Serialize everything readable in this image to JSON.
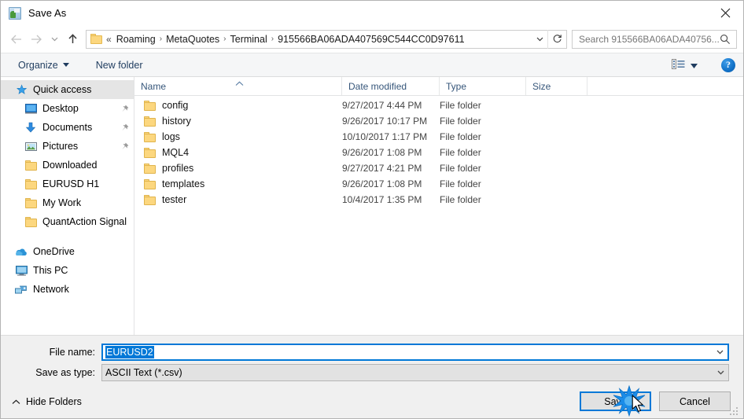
{
  "window": {
    "title": "Save As",
    "title_icon": "save-as-icon",
    "close_label": "✕"
  },
  "nav": {
    "back_icon": "arrow-left-icon",
    "forward_icon": "arrow-right-icon",
    "recent_icon": "chevron-down-icon",
    "up_icon": "arrow-up-icon",
    "address": {
      "folder_icon": "folder-icon",
      "overflow": "«",
      "crumbs": [
        "Roaming",
        "MetaQuotes",
        "Terminal",
        "915566BA06ADA407569C544CC0D97611"
      ],
      "separator": "›",
      "dropdown_icon": "chevron-down-icon",
      "refresh_icon": "refresh-icon"
    },
    "search": {
      "placeholder": "Search 915566BA06ADA40756...",
      "icon": "search-icon"
    }
  },
  "commandbar": {
    "organize_label": "Organize",
    "organize_caret": "chevron-down-icon",
    "new_folder_label": "New folder",
    "view_icon": "view-mode-icon",
    "view_caret": "chevron-down-icon",
    "help_label": "?"
  },
  "sidebar": {
    "items": [
      {
        "label": "Quick access",
        "icon": "star-pin-icon",
        "selected": true,
        "indent": false,
        "pinned": false
      },
      {
        "label": "Desktop",
        "icon": "desktop-icon",
        "selected": false,
        "indent": true,
        "pinned": true
      },
      {
        "label": "Documents",
        "icon": "documents-icon",
        "selected": false,
        "indent": true,
        "pinned": true
      },
      {
        "label": "Pictures",
        "icon": "pictures-icon",
        "selected": false,
        "indent": true,
        "pinned": true
      },
      {
        "label": "Downloaded",
        "icon": "folder-icon",
        "selected": false,
        "indent": true,
        "pinned": false
      },
      {
        "label": "EURUSD H1",
        "icon": "folder-icon",
        "selected": false,
        "indent": true,
        "pinned": false
      },
      {
        "label": "My Work",
        "icon": "folder-icon",
        "selected": false,
        "indent": true,
        "pinned": false
      },
      {
        "label": "QuantAction Signal",
        "icon": "folder-icon",
        "selected": false,
        "indent": true,
        "pinned": false
      }
    ],
    "roots": [
      {
        "label": "OneDrive",
        "icon": "onedrive-icon"
      },
      {
        "label": "This PC",
        "icon": "this-pc-icon"
      },
      {
        "label": "Network",
        "icon": "network-icon"
      }
    ]
  },
  "filelist": {
    "columns": {
      "name": "Name",
      "date_modified": "Date modified",
      "type": "Type",
      "size": "Size"
    },
    "sort": {
      "column": "Name",
      "direction": "ascending",
      "glyph": "˄"
    },
    "rows": [
      {
        "name": "config",
        "date_modified": "9/27/2017 4:44 PM",
        "type": "File folder",
        "size": ""
      },
      {
        "name": "history",
        "date_modified": "9/26/2017 10:17 PM",
        "type": "File folder",
        "size": ""
      },
      {
        "name": "logs",
        "date_modified": "10/10/2017 1:17 PM",
        "type": "File folder",
        "size": ""
      },
      {
        "name": "MQL4",
        "date_modified": "9/26/2017 1:08 PM",
        "type": "File folder",
        "size": ""
      },
      {
        "name": "profiles",
        "date_modified": "9/27/2017 4:21 PM",
        "type": "File folder",
        "size": ""
      },
      {
        "name": "templates",
        "date_modified": "9/26/2017 1:08 PM",
        "type": "File folder",
        "size": ""
      },
      {
        "name": "tester",
        "date_modified": "10/4/2017 1:35 PM",
        "type": "File folder",
        "size": ""
      }
    ]
  },
  "form": {
    "file_name_label": "File name:",
    "file_name_value": "EURUSD2",
    "file_name_selected": true,
    "save_as_type_label": "Save as type:",
    "save_as_type_value": "ASCII Text (*.csv)",
    "dropdown_icon": "chevron-down-icon"
  },
  "footer": {
    "hide_folders_label": "Hide Folders",
    "hide_folders_icon": "chevron-up-icon",
    "save_label": "Save",
    "cancel_label": "Cancel",
    "resize_grip_icon": "resize-grip-icon",
    "click_burst_icon": "click-burst-icon",
    "cursor_icon": "mouse-cursor-icon"
  },
  "colors": {
    "accent": "#0078d7",
    "folder": "#fcd77f",
    "header_text": "#36567a",
    "command_text": "#1f3c5f"
  }
}
